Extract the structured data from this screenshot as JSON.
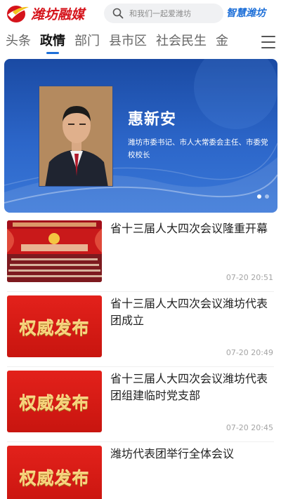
{
  "header": {
    "logo_text": "潍坊融媒",
    "search_placeholder": "和我们一起爱潍坊",
    "brand_link": "智慧潍坊",
    "colors": {
      "brand_red": "#d5131b",
      "accent_blue": "#1d6fd8"
    }
  },
  "tabs": [
    {
      "label": "头条"
    },
    {
      "label": "政情"
    },
    {
      "label": "部门"
    },
    {
      "label": "县市区"
    },
    {
      "label": "社会民生"
    },
    {
      "label": "金"
    }
  ],
  "active_tab": "政情",
  "banner": {
    "name": "惠新安",
    "title": "潍坊市委书记、市人大常委会主任、市委党校校长",
    "slides_total": 2,
    "current_slide": 1
  },
  "news": [
    {
      "title": "省十三届人大四次会议隆重开幕",
      "time": "07-20 20:51",
      "thumb": "assembly-hall-photo"
    },
    {
      "title": "省十三届人大四次会议潍坊代表团成立",
      "time": "07-20 20:49",
      "thumb_text": "权威发布"
    },
    {
      "title": "省十三届人大四次会议潍坊代表团组建临时党支部",
      "time": "07-20 20:45",
      "thumb_text": "权威发布"
    },
    {
      "title": "潍坊代表团举行全体会议",
      "time": "",
      "thumb_text": "权威发布"
    }
  ]
}
